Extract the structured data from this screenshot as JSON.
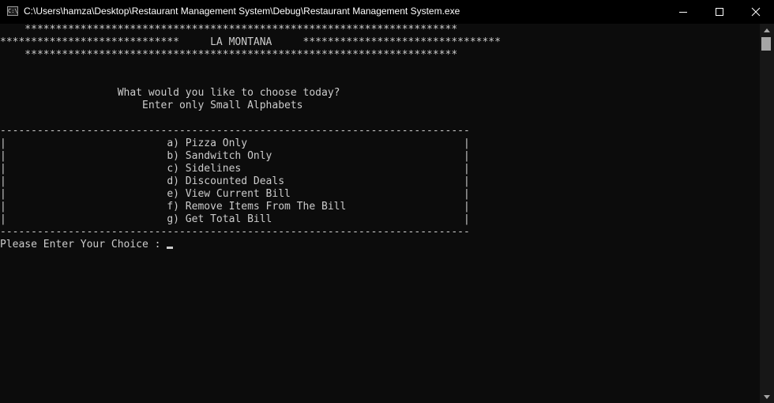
{
  "window": {
    "title": "C:\\Users\\hamza\\Desktop\\Restaurant Management System\\Debug\\Restaurant Management System.exe",
    "icon": "console-app-icon",
    "icon_text": "C:\\",
    "controls": [
      "minimize-icon",
      "maximize-icon",
      "close-icon"
    ]
  },
  "console": {
    "lines": [
      "    **********************************************************************",
      "*****************************     LA MONTANA     ********************************",
      "    **********************************************************************",
      "",
      "",
      "                   What would you like to choose today?",
      "                       Enter only Small Alphabets",
      "",
      "----------------------------------------------------------------------------",
      "|                          a) Pizza Only                                   |",
      "|                          b) Sandwitch Only                               |",
      "|                          c) Sidelines                                    |",
      "|                          d) Discounted Deals                             |",
      "|                          e) View Current Bill                            |",
      "|                          f) Remove Items From The Bill                   |",
      "|                          g) Get Total Bill                               |",
      "----------------------------------------------------------------------------",
      "Please Enter Your Choice : "
    ]
  },
  "colors": {
    "console_bg": "#0c0c0c",
    "console_fg": "#cccccc",
    "titlebar_bg": "#000000",
    "titlebar_fg": "#ffffff"
  }
}
